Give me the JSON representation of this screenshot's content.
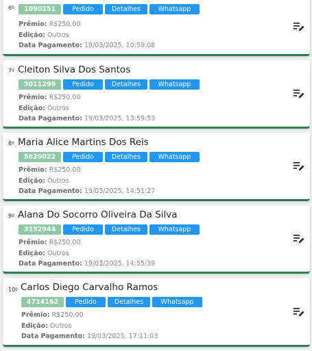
{
  "labels": {
    "pedido": "Pedido",
    "detalhes": "Detalhes",
    "whatsapp": "Whatsapp",
    "premio": "Prêmio:",
    "edicao": "Edição:",
    "data_pagamento": "Data Pagamento:"
  },
  "cards": [
    {
      "rank": "6º",
      "name": "",
      "code": "1090251",
      "premio": "R$250,00",
      "edicao": "Outros",
      "data_pagamento": "19/03/2025, 10:59:08"
    },
    {
      "rank": "7º",
      "name": "Cleiton Silva Dos Santos",
      "code": "3011296",
      "premio": "R$250,00",
      "edicao": "Outros",
      "data_pagamento": "19/03/2025, 13:59:53"
    },
    {
      "rank": "8º",
      "name": "Maria Alice Martins Dos Reis",
      "code": "5629022",
      "premio": "R$250,00",
      "edicao": "Outros",
      "data_pagamento": "19/03/2025, 14:51:27"
    },
    {
      "rank": "9º",
      "name": "Alana Do Socorro Oliveira Da Silva",
      "code": "3252944",
      "premio": "R$250,00",
      "edicao": "Outros",
      "data_pagamento": "19/03/2025, 14:55:39"
    },
    {
      "rank": "10º",
      "name": "Carlos Diego Carvalho Ramos",
      "code": "4714162",
      "premio": "R$250,00",
      "edicao": "Outros",
      "data_pagamento": "19/03/2025, 17:11:03"
    }
  ],
  "icons": {
    "edit": "edit-list-icon"
  }
}
